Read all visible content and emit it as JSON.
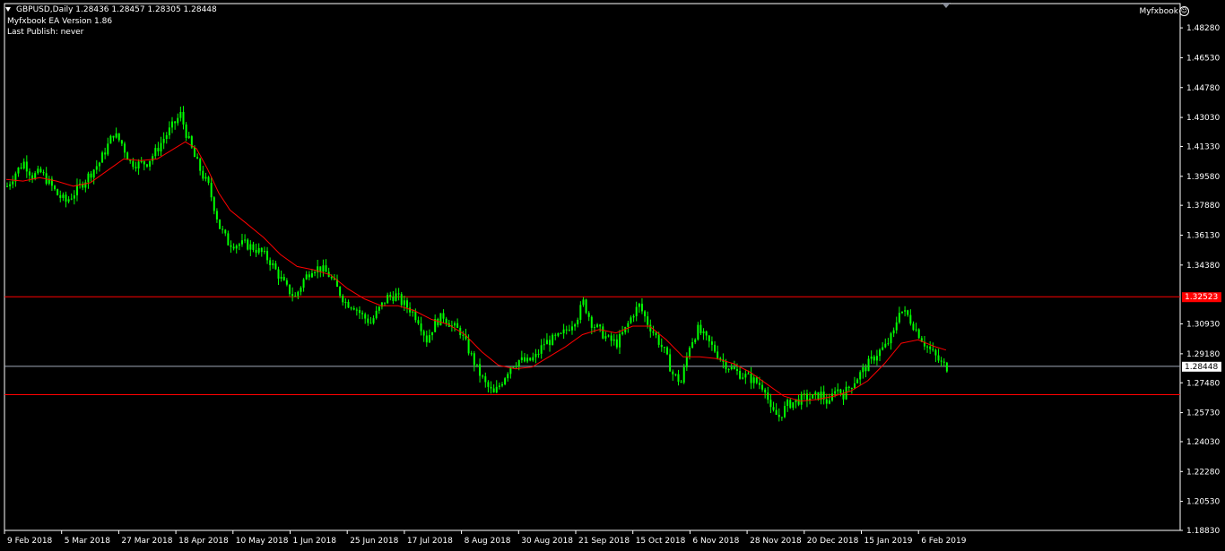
{
  "header": {
    "symbol_line": "GBPUSD,Daily  1.28436 1.28457 1.28305 1.28448",
    "ea_line": "Myfxbook EA Version 1.86",
    "publish_line": "Last Publish: never",
    "brand": "Myfxbook"
  },
  "colors": {
    "background": "#000000",
    "candle": "#00ff00",
    "ma": "#ff0000",
    "level_line": "#ff0000",
    "bid_line": "#a0a8b8",
    "axis": "#ffffff",
    "label_bg_level": "#ff0000",
    "label_bg_bid": "#ffffff"
  },
  "icons": {
    "menu": "triangle-down-icon",
    "brand": "smiley-icon",
    "shift": "chart-shift-triangle-icon"
  },
  "chart_data": {
    "type": "candlestick",
    "symbol": "GBPUSD",
    "timeframe": "Daily",
    "ylim": [
      1.1883,
      1.4965
    ],
    "y_ticks": [
      "1.48280",
      "1.46530",
      "1.44780",
      "1.43030",
      "1.41330",
      "1.39580",
      "1.37880",
      "1.36130",
      "1.34380",
      "1.32523",
      "1.30930",
      "1.29180",
      "1.28448",
      "1.27480",
      "1.25730",
      "1.24030",
      "1.22280",
      "1.20530",
      "1.18830"
    ],
    "x_ticks": [
      "9 Feb 2018",
      "5 Mar 2018",
      "27 Mar 2018",
      "18 Apr 2018",
      "10 May 2018",
      "1 Jun 2018",
      "25 Jun 2018",
      "17 Jul 2018",
      "8 Aug 2018",
      "30 Aug 2018",
      "21 Sep 2018",
      "15 Oct 2018",
      "6 Nov 2018",
      "28 Nov 2018",
      "20 Dec 2018",
      "15 Jan 2019",
      "6 Feb 2019"
    ],
    "horizontal_levels": [
      {
        "label": "1.32523",
        "value": 1.32523,
        "style": "level"
      },
      {
        "label": "1.28448",
        "value": 1.28448,
        "style": "bid"
      },
      {
        "label": "1.26786",
        "value": 1.26786,
        "style": "level"
      }
    ],
    "close_path": [
      [
        0,
        1.39
      ],
      [
        3,
        1.398
      ],
      [
        6,
        1.404
      ],
      [
        9,
        1.396
      ],
      [
        12,
        1.398
      ],
      [
        15,
        1.392
      ],
      [
        18,
        1.385
      ],
      [
        21,
        1.381
      ],
      [
        24,
        1.386
      ],
      [
        27,
        1.392
      ],
      [
        30,
        1.398
      ],
      [
        33,
        1.404
      ],
      [
        36,
        1.414
      ],
      [
        38,
        1.421
      ],
      [
        41,
        1.415
      ],
      [
        44,
        1.404
      ],
      [
        47,
        1.403
      ],
      [
        50,
        1.404
      ],
      [
        53,
        1.41
      ],
      [
        56,
        1.418
      ],
      [
        59,
        1.425
      ],
      [
        62,
        1.432
      ],
      [
        64,
        1.421
      ],
      [
        67,
        1.407
      ],
      [
        70,
        1.396
      ],
      [
        72,
        1.39
      ],
      [
        74,
        1.378
      ],
      [
        76,
        1.366
      ],
      [
        79,
        1.357
      ],
      [
        82,
        1.356
      ],
      [
        85,
        1.356
      ],
      [
        88,
        1.354
      ],
      [
        91,
        1.351
      ],
      [
        94,
        1.346
      ],
      [
        97,
        1.338
      ],
      [
        100,
        1.33
      ],
      [
        103,
        1.325
      ],
      [
        106,
        1.335
      ],
      [
        109,
        1.342
      ],
      [
        112,
        1.342
      ],
      [
        115,
        1.338
      ],
      [
        118,
        1.33
      ],
      [
        121,
        1.322
      ],
      [
        124,
        1.32
      ],
      [
        127,
        1.314
      ],
      [
        130,
        1.31
      ],
      [
        133,
        1.318
      ],
      [
        136,
        1.325
      ],
      [
        139,
        1.326
      ],
      [
        141,
        1.322
      ],
      [
        144,
        1.318
      ],
      [
        147,
        1.312
      ],
      [
        150,
        1.3
      ],
      [
        153,
        1.31
      ],
      [
        156,
        1.314
      ],
      [
        159,
        1.308
      ],
      [
        162,
        1.305
      ],
      [
        165,
        1.294
      ],
      [
        168,
        1.283
      ],
      [
        171,
        1.274
      ],
      [
        174,
        1.268
      ],
      [
        177,
        1.276
      ],
      [
        180,
        1.285
      ],
      [
        183,
        1.288
      ],
      [
        186,
        1.287
      ],
      [
        189,
        1.29
      ],
      [
        192,
        1.298
      ],
      [
        195,
        1.3
      ],
      [
        198,
        1.302
      ],
      [
        201,
        1.308
      ],
      [
        204,
        1.314
      ],
      [
        206,
        1.322
      ],
      [
        209,
        1.31
      ],
      [
        212,
        1.305
      ],
      [
        215,
        1.3
      ],
      [
        218,
        1.298
      ],
      [
        221,
        1.306
      ],
      [
        224,
        1.316
      ],
      [
        226,
        1.32
      ],
      [
        229,
        1.31
      ],
      [
        232,
        1.302
      ],
      [
        235,
        1.293
      ],
      [
        238,
        1.28
      ],
      [
        241,
        1.275
      ],
      [
        244,
        1.297
      ],
      [
        247,
        1.306
      ],
      [
        250,
        1.3
      ],
      [
        253,
        1.294
      ],
      [
        256,
        1.287
      ],
      [
        259,
        1.283
      ],
      [
        262,
        1.28
      ],
      [
        265,
        1.278
      ],
      [
        268,
        1.275
      ],
      [
        271,
        1.272
      ],
      [
        273,
        1.258
      ],
      [
        276,
        1.255
      ],
      [
        279,
        1.262
      ],
      [
        282,
        1.264
      ],
      [
        285,
        1.266
      ],
      [
        288,
        1.266
      ],
      [
        291,
        1.268
      ],
      [
        294,
        1.262
      ],
      [
        296,
        1.272
      ],
      [
        299,
        1.268
      ],
      [
        302,
        1.274
      ],
      [
        305,
        1.28
      ],
      [
        308,
        1.286
      ],
      [
        311,
        1.292
      ],
      [
        314,
        1.296
      ],
      [
        317,
        1.304
      ],
      [
        319,
        1.318
      ],
      [
        322,
        1.314
      ],
      [
        325,
        1.306
      ],
      [
        328,
        1.298
      ],
      [
        331,
        1.292
      ],
      [
        334,
        1.286
      ],
      [
        336,
        1.284
      ]
    ],
    "ma_path": [
      [
        0,
        1.394
      ],
      [
        6,
        1.393
      ],
      [
        12,
        1.395
      ],
      [
        18,
        1.393
      ],
      [
        24,
        1.39
      ],
      [
        30,
        1.392
      ],
      [
        36,
        1.399
      ],
      [
        42,
        1.406
      ],
      [
        48,
        1.405
      ],
      [
        54,
        1.406
      ],
      [
        60,
        1.412
      ],
      [
        64,
        1.416
      ],
      [
        68,
        1.412
      ],
      [
        72,
        1.4
      ],
      [
        76,
        1.386
      ],
      [
        80,
        1.376
      ],
      [
        86,
        1.368
      ],
      [
        92,
        1.36
      ],
      [
        98,
        1.35
      ],
      [
        104,
        1.343
      ],
      [
        110,
        1.341
      ],
      [
        116,
        1.338
      ],
      [
        122,
        1.33
      ],
      [
        128,
        1.324
      ],
      [
        134,
        1.32
      ],
      [
        140,
        1.32
      ],
      [
        146,
        1.317
      ],
      [
        152,
        1.312
      ],
      [
        158,
        1.309
      ],
      [
        164,
        1.303
      ],
      [
        170,
        1.293
      ],
      [
        176,
        1.285
      ],
      [
        182,
        1.283
      ],
      [
        188,
        1.284
      ],
      [
        194,
        1.29
      ],
      [
        200,
        1.296
      ],
      [
        206,
        1.303
      ],
      [
        212,
        1.306
      ],
      [
        218,
        1.304
      ],
      [
        224,
        1.308
      ],
      [
        230,
        1.308
      ],
      [
        236,
        1.3
      ],
      [
        242,
        1.29
      ],
      [
        248,
        1.29
      ],
      [
        254,
        1.289
      ],
      [
        260,
        1.286
      ],
      [
        266,
        1.281
      ],
      [
        272,
        1.274
      ],
      [
        278,
        1.267
      ],
      [
        284,
        1.264
      ],
      [
        290,
        1.265
      ],
      [
        296,
        1.267
      ],
      [
        302,
        1.27
      ],
      [
        308,
        1.276
      ],
      [
        314,
        1.286
      ],
      [
        320,
        1.298
      ],
      [
        326,
        1.3
      ],
      [
        332,
        1.296
      ],
      [
        336,
        1.294
      ]
    ]
  }
}
